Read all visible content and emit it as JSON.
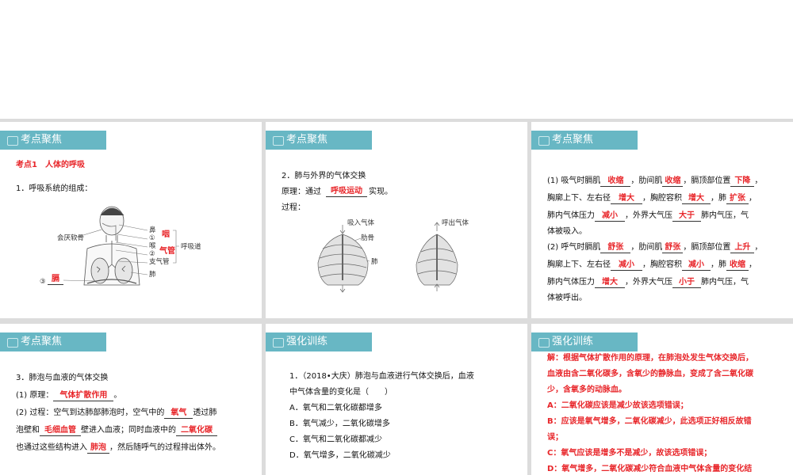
{
  "slide1": {
    "tab": "考点聚焦",
    "heading": "考点1　人体的呼吸",
    "item1": "1．呼吸系统的组成：",
    "labels": {
      "nose": "鼻",
      "c1": "①",
      "larynx": "喉",
      "c2": "②",
      "bronchi": "支气管",
      "lung": "肺",
      "epiglottis": "会厌软骨",
      "airway": "呼吸道",
      "c3": "③"
    },
    "answers": {
      "a1": "咽",
      "a2": "气管",
      "a3": "膈"
    }
  },
  "slide2": {
    "tab": "考点聚焦",
    "item2": "2．肺与外界的气体交换",
    "principle_pre": "原理：通过",
    "principle_ans": "呼吸运动",
    "principle_post": "实现。",
    "process": "过程：",
    "fig_in": "吸入气体",
    "fig_rib": "肋骨",
    "fig_lung": "肺",
    "fig_out": "呼出气体"
  },
  "slide3": {
    "tab": "考点聚焦",
    "l1": [
      "(1) 吸气时膈肌",
      "，肋间肌",
      "，膈顶部位置",
      "，"
    ],
    "l1a": [
      "收缩",
      "收缩",
      "下降"
    ],
    "l2": [
      "胸廓上下、左右径",
      "，胸腔容积",
      "，肺",
      "，"
    ],
    "l2a": [
      "增大",
      "增大",
      "扩张"
    ],
    "l3": [
      "肺内气体压力",
      "，外界大气压",
      "肺内气压，气"
    ],
    "l3a": [
      "减小",
      "大于"
    ],
    "l4": "体被吸入。",
    "l5": [
      "(2) 呼气时膈肌",
      "，肋间肌",
      "，膈顶部位置",
      "，"
    ],
    "l5a": [
      "舒张",
      "舒张",
      "上升"
    ],
    "l6": [
      "胸廓上下、左右径",
      "，胸腔容积",
      "，肺",
      "，"
    ],
    "l6a": [
      "减小",
      "减小",
      "收缩"
    ],
    "l7": [
      "肺内气体压力",
      "，外界大气压",
      "肺内气压，气"
    ],
    "l7a": [
      "增大",
      "小于"
    ],
    "l8": "体被呼出。"
  },
  "slide4": {
    "tab": "考点聚焦",
    "item3": "3．肺泡与血液的气体交换",
    "p1_pre": "(1) 原理：",
    "p1_ans": "气体扩散作用",
    "p1_post": "。",
    "p2_a": "(2) 过程：空气到达肺部肺泡时，空气中的",
    "p2_ans1": "氧气",
    "p2_b": "透过肺",
    "p3_a": "泡壁和",
    "p3_ans2": "毛细血管",
    "p3_b": "壁进入血液；同时血液中的",
    "p3_ans3": "二氧化碳",
    "p4_a": "也通过这些结构进入",
    "p4_ans4": "肺泡",
    "p4_b": "，然后随呼气的过程排出体外。"
  },
  "slide5": {
    "tab": "强化训练",
    "q": "1．（2018•大庆）肺泡与血液进行气体交换后，血液",
    "q2": "中气体含量的变化是（　　）",
    "options": [
      "A．氧气和二氧化碳都增多",
      "B．氧气减少，二氧化碳增多",
      "C．氧气和二氧化碳都减少",
      "D．氧气增多，二氧化碳减少"
    ]
  },
  "slide6": {
    "tab": "强化训练",
    "lines": [
      "解：根据气体扩散作用的原理，在肺泡处发生气体交换后，",
      "血液由含二氧化碳多，含氧少的静脉血，变成了含二氧化碳",
      "少，含氧多的动脉血。",
      "A：二氧化碳应该是减少故该选项错误；",
      "B：应该是氧气增多，二氧化碳减少，此选项正好相反故错",
      "误；",
      "C：氧气应该是增多不是减少，故该选项错误；",
      "D：氧气增多，二氧化碳减少符合血液中气体含量的变化结"
    ]
  }
}
